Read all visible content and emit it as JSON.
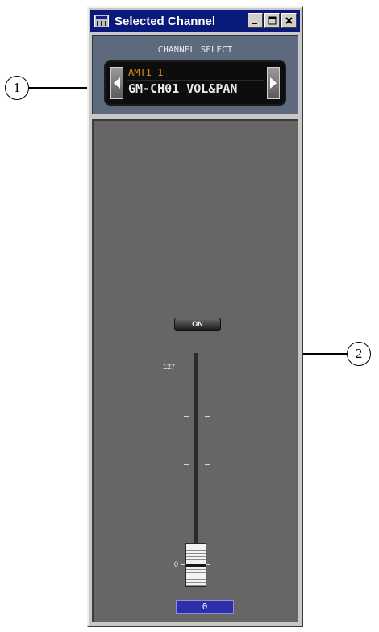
{
  "window": {
    "title": "Selected Channel",
    "controls": [
      "minimize",
      "maximize",
      "close"
    ]
  },
  "channel_select": {
    "label": "CHANNEL SELECT",
    "line1": "AMT1-1",
    "line2": "GM-CH01 VOL&PAN",
    "line1_color": "#d98c1e"
  },
  "fader": {
    "on_label": "ON",
    "scale_max_label": "127",
    "scale_min_label": "0",
    "value": "0",
    "level_fraction": 0
  },
  "callouts": [
    {
      "number": "1"
    },
    {
      "number": "2"
    }
  ],
  "colors": {
    "title_bar": "#0a1a7a",
    "select_panel": "#5d6a7e",
    "fader_panel": "#666666",
    "value_box": "#2e2ea8"
  },
  "icons": {
    "app": "app-icon",
    "minimize": "minimize-icon",
    "maximize": "maximize-icon",
    "close": "close-icon",
    "prev": "arrow-left-icon",
    "next": "arrow-right-icon"
  }
}
